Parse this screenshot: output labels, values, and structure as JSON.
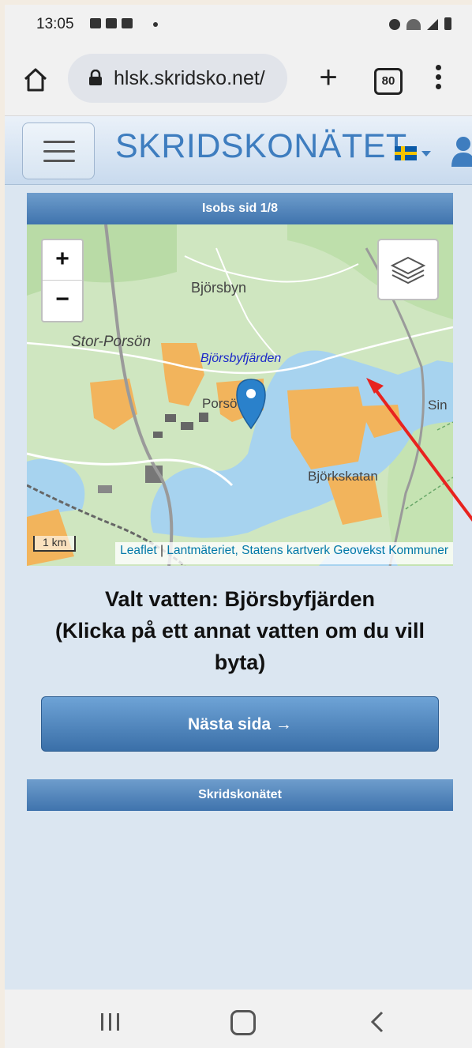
{
  "status": {
    "time": "13:05"
  },
  "browser": {
    "url": "hlsk.skridsko.net/",
    "tab_count": "80",
    "new_tab": "+"
  },
  "header": {
    "logo": "SKRIDSKONÄTET"
  },
  "panel": {
    "title": "Isobs sid 1/8"
  },
  "map": {
    "zoom_in": "+",
    "zoom_out": "−",
    "labels": {
      "bjorsbyn": "Björsbyn",
      "stor_porson": "Stor-Porsön",
      "bjorsbyfjarden": "Björsbyfjärden",
      "porson": "Porsö",
      "bjorkskatan": "Björkskatan",
      "sin": "Sin"
    },
    "scale": "1 km",
    "attribution": {
      "leaflet": "Leaflet",
      "sep": " | ",
      "sources": "Lantmäteriet, Statens kartverk Geovekst Kommuner"
    }
  },
  "selection": {
    "line1": "Valt vatten: Björsbyfjärden",
    "line2": "(Klicka på ett annat vatten om du vill byta)"
  },
  "next_button": "Nästa sida →",
  "footer": "Skridskonätet"
}
